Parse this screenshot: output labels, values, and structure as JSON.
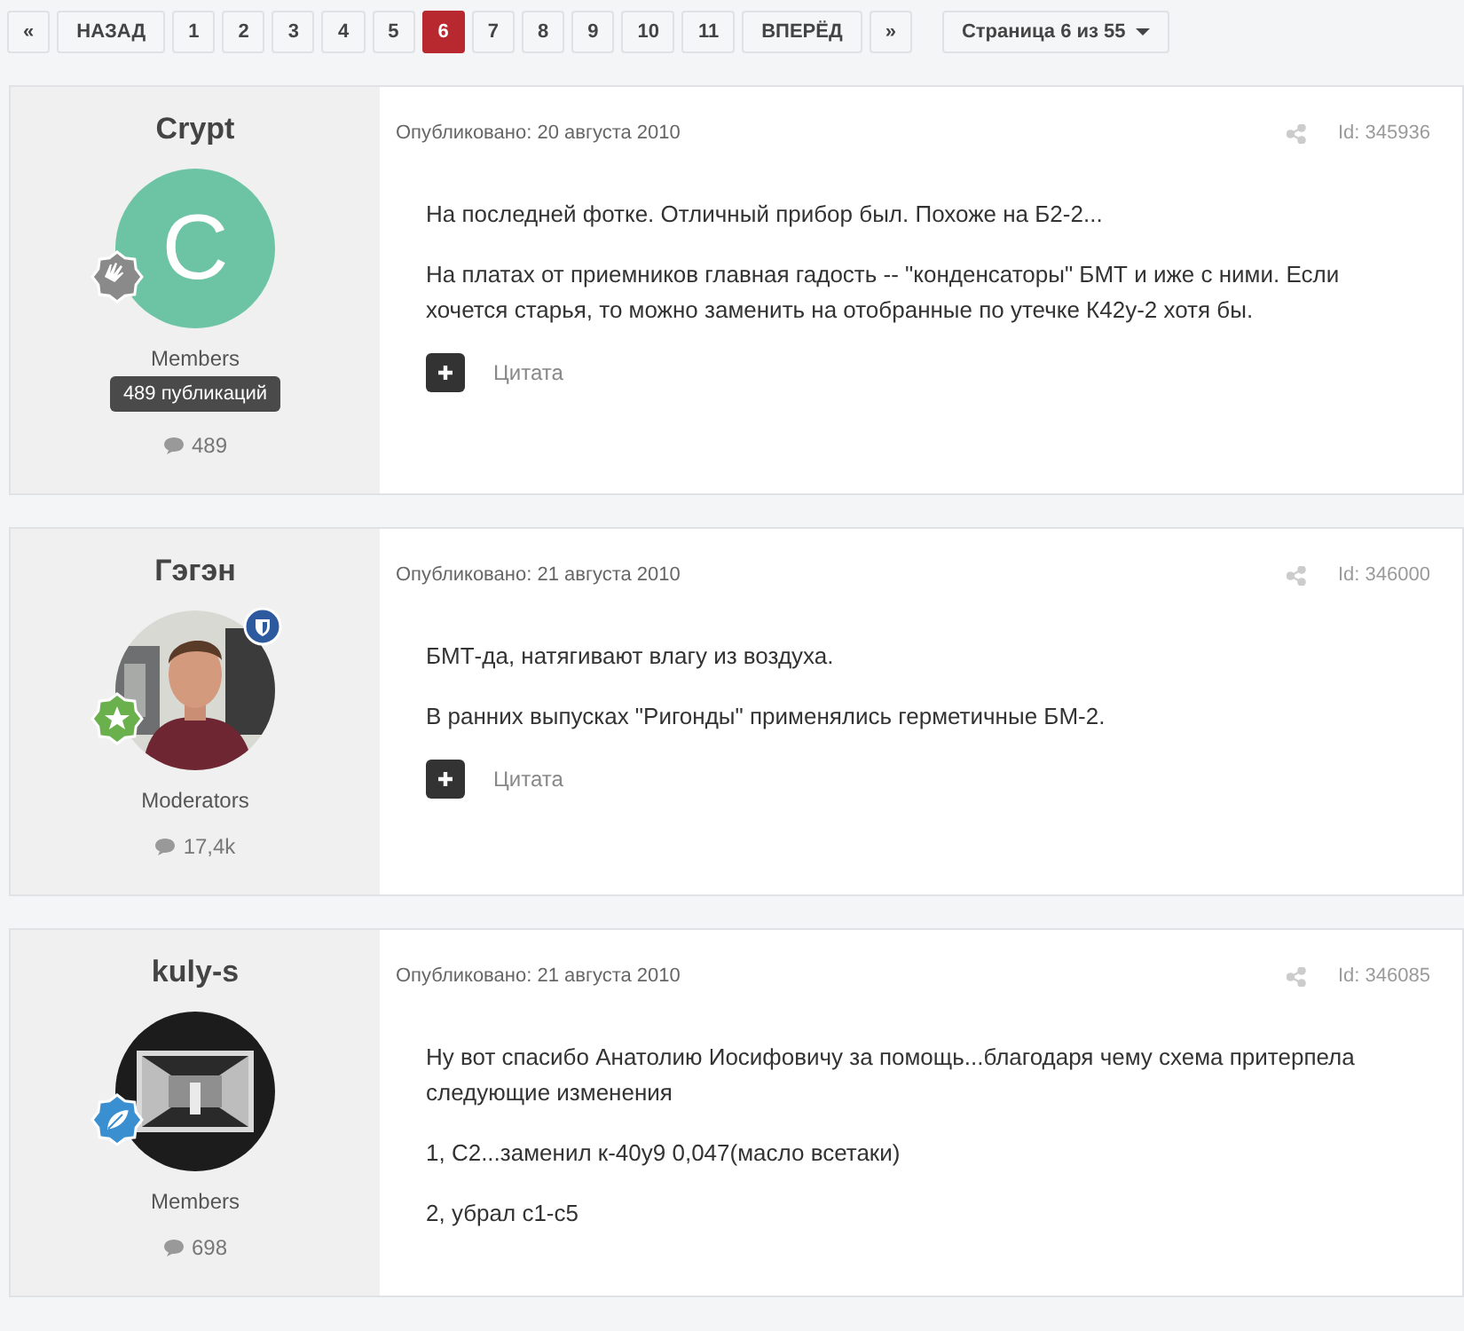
{
  "pagination": {
    "first": "«",
    "prev": "НАЗАД",
    "pages": [
      {
        "label": "1",
        "selected": false
      },
      {
        "label": "2",
        "selected": false
      },
      {
        "label": "3",
        "selected": false
      },
      {
        "label": "4",
        "selected": false
      },
      {
        "label": "5",
        "selected": false
      },
      {
        "label": "6",
        "selected": true
      },
      {
        "label": "7",
        "selected": false
      },
      {
        "label": "8",
        "selected": false
      },
      {
        "label": "9",
        "selected": false
      },
      {
        "label": "10",
        "selected": false
      },
      {
        "label": "11",
        "selected": false
      }
    ],
    "next": "ВПЕРЁД",
    "last": "»",
    "page_menu": "Страница 6 из 55"
  },
  "posts": [
    {
      "author": "Crypt",
      "avatar": {
        "kind": "letter",
        "letter": "C"
      },
      "rank_badge": {
        "kind": "hand"
      },
      "moderator": false,
      "group": "Members",
      "tooltip": "489 публикаций",
      "post_count": "489",
      "date": "Опубликовано: 20 августа 2010",
      "id": "Id: 345936",
      "paragraphs": [
        "На последней фотке. Отличный прибор был. Похоже на Б2-2...",
        "На платах от приемников главная гадость -- \"конденсаторы\" БМТ и иже с ними. Если хочется старья, то можно заменить на отобранные по утечке К42у-2 хотя бы."
      ],
      "quote_label": "Цитата"
    },
    {
      "author": "Гэгэн",
      "avatar": {
        "kind": "picture"
      },
      "rank_badge": {
        "kind": "star"
      },
      "moderator": true,
      "group": "Moderators",
      "post_count": "17,4k",
      "date": "Опубликовано: 21 августа 2010",
      "id": "Id: 346000",
      "paragraphs": [
        "БМТ-да, натягивают влагу из воздуха.",
        "В ранних выпусках \"Ригонды\" применялись герметичные БМ-2."
      ],
      "quote_label": "Цитата"
    },
    {
      "author": "kuly-s",
      "avatar": {
        "kind": "picture"
      },
      "rank_badge": {
        "kind": "leaf"
      },
      "moderator": false,
      "group": "Members",
      "post_count": "698",
      "date": "Опубликовано: 21 августа 2010",
      "id": "Id: 346085",
      "paragraphs": [
        "Ну вот спасибо Анатолию Иосифовичу за помощь...благодаря чему схема притерпела следующие изменения",
        "1, C2...заменил к-40у9 0,047(масло всетаки)",
        "2, убрал с1-с5"
      ]
    }
  ]
}
